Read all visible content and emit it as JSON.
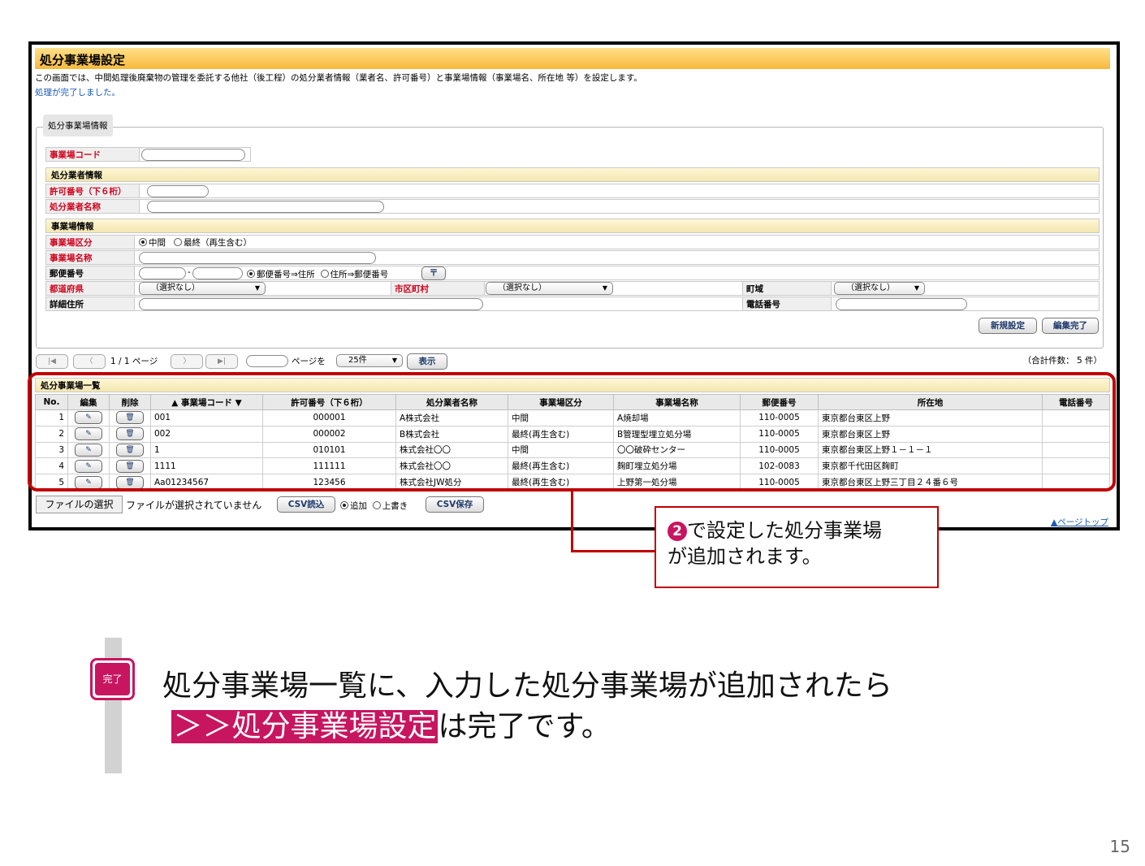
{
  "screen": {
    "title": "処分事業場設定",
    "description": "この画面では、中間処理後廃棄物の管理を委託する他社（後工程）の処分業者情報（業者名、許可番号）と事業場情報（事業場名、所在地 等）を設定します。",
    "done_message": "処理が完了しました。",
    "legend": "処分事業場情報",
    "form": {
      "code_label": "事業場コード",
      "contractor_section": "処分業者情報",
      "permit_label": "許可番号（下６桁）",
      "contractor_name_label": "処分業者名称",
      "site_section": "事業場情報",
      "site_type_label": "事業場区分",
      "site_type_options": [
        "中間",
        "最終（再生含む）"
      ],
      "site_name_label": "事業場名称",
      "postal_label": "郵便番号",
      "postal_dash": "-",
      "radio_postal_to_addr": "郵便番号⇒住所",
      "radio_addr_to_postal": "住所⇒郵便番号",
      "postal_btn": "〒",
      "pref_label": "都道府県",
      "pref_value": "（選択なし）",
      "city_label": "市区町村",
      "city_value": "（選択なし）",
      "town_label": "町域",
      "town_value": "（選択なし）",
      "address_label": "詳細住所",
      "phone_label": "電話番号",
      "new_button": "新規設定",
      "edit_done_button": "編集完了"
    },
    "pager": {
      "first": "|◀",
      "prev": "〈",
      "page_info": "1 / 1 ページ",
      "next": "〉",
      "last": "▶|",
      "goto_label": "ページを",
      "per_page": "25件",
      "show_button": "表示",
      "total": "（合計件数： 5 件）"
    },
    "list": {
      "title": "処分事業場一覧",
      "columns": [
        "No.",
        "編集",
        "削除",
        "事業場コード",
        "許可番号（下６桁）",
        "処分業者名称",
        "事業場区分",
        "事業場名称",
        "郵便番号",
        "所在地",
        "電話番号"
      ],
      "rows": [
        {
          "no": "1",
          "code": "001",
          "permit": "000001",
          "contractor": "A株式会社",
          "type": "中間",
          "site": "A焼却場",
          "postal": "110-0005",
          "address": "東京都台東区上野",
          "phone": ""
        },
        {
          "no": "2",
          "code": "002",
          "permit": "000002",
          "contractor": "B株式会社",
          "type": "最終(再生含む)",
          "site": "B管理型埋立処分場",
          "postal": "110-0005",
          "address": "東京都台東区上野",
          "phone": ""
        },
        {
          "no": "3",
          "code": "1",
          "permit": "010101",
          "contractor": "株式会社〇〇",
          "type": "中間",
          "site": "〇〇破砕センター",
          "postal": "110-0005",
          "address": "東京都台東区上野１－１－１",
          "phone": ""
        },
        {
          "no": "4",
          "code": "1111",
          "permit": "111111",
          "contractor": "株式会社〇〇",
          "type": "最終(再生含む)",
          "site": "麹町埋立処分場",
          "postal": "102-0083",
          "address": "東京都千代田区麹町",
          "phone": ""
        },
        {
          "no": "5",
          "code": "Aa01234567",
          "permit": "123456",
          "contractor": "株式会社JW処分",
          "type": "最終(再生含む)",
          "site": "上野第一処分場",
          "postal": "110-0005",
          "address": "東京都台東区上野三丁目２４番６号",
          "phone": ""
        }
      ]
    },
    "file": {
      "choose_button": "ファイルの選択",
      "no_file": "ファイルが選択されていません",
      "csv_import": "CSV読込",
      "mode_add": "追加",
      "mode_overwrite": "上書き",
      "csv_save": "CSV保存"
    },
    "page_top": "▲ページトップ"
  },
  "callout": {
    "number": "2",
    "line1": "で設定した処分事業場",
    "line2": "が追加されます。"
  },
  "footer": {
    "badge": "完了",
    "line1": "処分事業場一覧に、入力した処分事業場が追加されたら",
    "highlight": "＞＞処分事業場設定",
    "line2_rest": "は完了です。",
    "page_number": "15"
  },
  "colors": {
    "accent": "#c8155f",
    "frame_red": "#c00000",
    "title_bar": "#f6b93b"
  }
}
